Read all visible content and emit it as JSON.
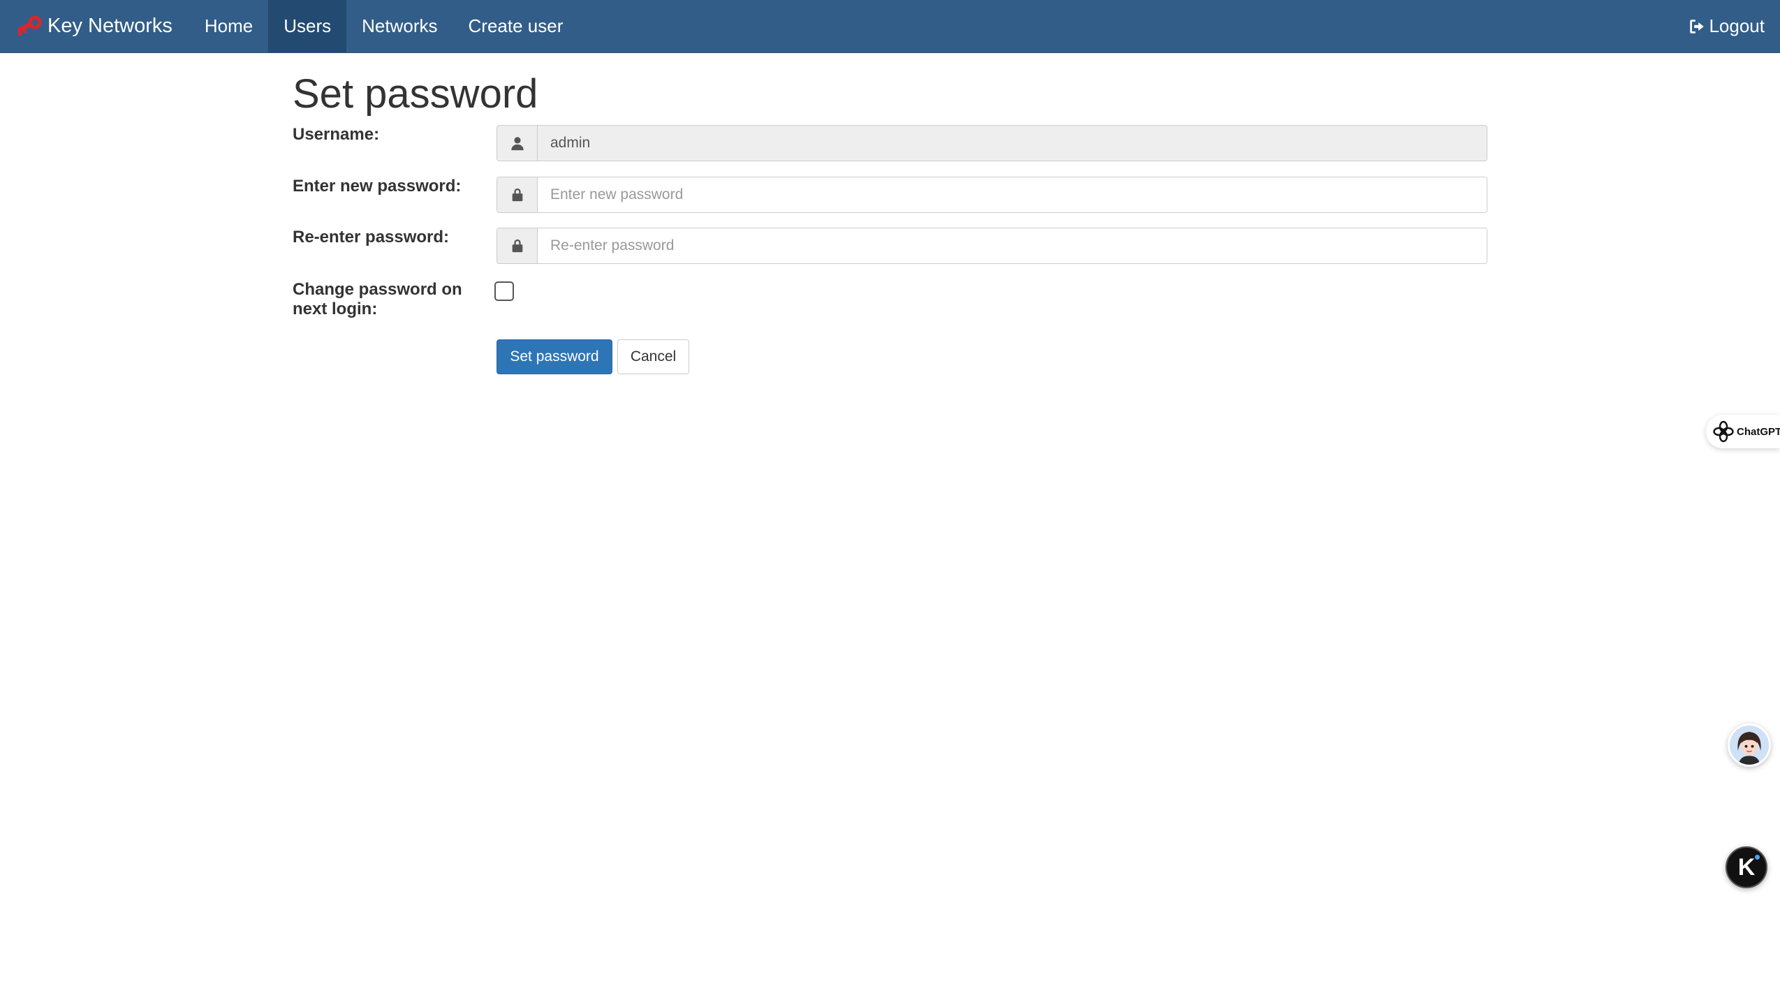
{
  "navbar": {
    "brand": "Key Networks",
    "items": [
      {
        "label": "Home",
        "active": false
      },
      {
        "label": "Users",
        "active": true
      },
      {
        "label": "Networks",
        "active": false
      },
      {
        "label": "Create user",
        "active": false
      }
    ],
    "logout": "Logout",
    "logo_icon": "key-icon",
    "logo_color": "#d9262b",
    "background_color": "#325d88"
  },
  "page": {
    "title": "Set password"
  },
  "form": {
    "username": {
      "label": "Username:",
      "value": "admin",
      "icon": "user-icon"
    },
    "new_password": {
      "label": "Enter new password:",
      "placeholder": "Enter new password",
      "value": "",
      "icon": "lock-icon"
    },
    "reenter_password": {
      "label": "Re-enter password:",
      "placeholder": "Re-enter password",
      "value": "",
      "icon": "lock-icon"
    },
    "change_on_login": {
      "label_line1": "Change password on",
      "label_line2": "next login:",
      "checked": false
    },
    "submit_label": "Set password",
    "cancel_label": "Cancel",
    "primary_color": "#2e75b6"
  },
  "widgets": {
    "chatgpt_label": "ChatGPT",
    "k_label": "K"
  }
}
